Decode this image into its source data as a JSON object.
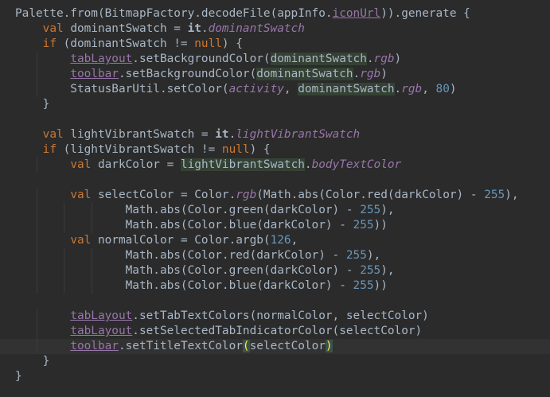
{
  "editor": {
    "language": "Kotlin",
    "theme": "Darcula",
    "colors": {
      "background": "#2b2b2b",
      "text": "#a9b7c6",
      "keyword": "#cc7832",
      "number": "#6897bb",
      "property": "#9876aa",
      "highlight": "#344134",
      "brace_match": "#ffef28"
    },
    "lines": [
      "Palette.from(BitmapFactory.decodeFile(appInfo.iconUrl)).generate {",
      "    val dominantSwatch = it.dominantSwatch",
      "    if (dominantSwatch != null) {",
      "        tabLayout.setBackgroundColor(dominantSwatch.rgb)",
      "        toolbar.setBackgroundColor(dominantSwatch.rgb)",
      "        StatusBarUtil.setColor(activity, dominantSwatch.rgb, 80)",
      "    }",
      "",
      "    val lightVibrantSwatch = it.lightVibrantSwatch",
      "    if (lightVibrantSwatch != null) {",
      "        val darkColor = lightVibrantSwatch.bodyTextColor",
      "",
      "        val selectColor = Color.rgb(Math.abs(Color.red(darkColor) - 255),",
      "                Math.abs(Color.green(darkColor) - 255),",
      "                Math.abs(Color.blue(darkColor) - 255))",
      "        val normalColor = Color.argb(126,",
      "                Math.abs(Color.red(darkColor) - 255),",
      "                Math.abs(Color.green(darkColor) - 255),",
      "                Math.abs(Color.blue(darkColor) - 255))",
      "",
      "        tabLayout.setTabTextColors(normalColor, selectColor)",
      "        tabLayout.setSelectedTabIndicatorColor(selectColor)",
      "        toolbar.setTitleTextColor(selectColor)",
      "    }",
      "}"
    ]
  }
}
